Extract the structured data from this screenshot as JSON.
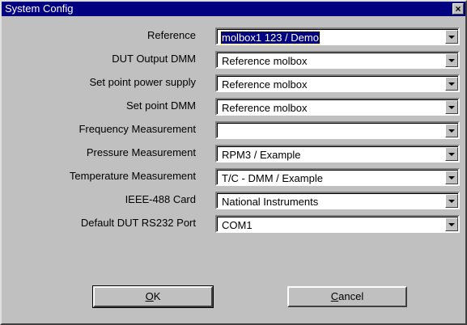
{
  "window": {
    "title": "System Config",
    "close_glyph": "×"
  },
  "fields": [
    {
      "label": "Reference",
      "value": "molbox1 123 / Demo",
      "selected": true
    },
    {
      "label": "DUT Output DMM",
      "value": "Reference molbox"
    },
    {
      "label": "Set point power supply",
      "value": "Reference molbox"
    },
    {
      "label": "Set point DMM",
      "value": "Reference molbox"
    },
    {
      "label": "Frequency Measurement",
      "value": ""
    },
    {
      "label": "Pressure Measurement",
      "value": "RPM3  / Example"
    },
    {
      "label": "Temperature Measurement",
      "value": "T/C - DMM  / Example"
    },
    {
      "label": "IEEE-488 Card",
      "value": "National Instruments"
    },
    {
      "label": "Default DUT RS232 Port",
      "value": "COM1"
    }
  ],
  "buttons": {
    "ok_mnemonic": "O",
    "ok_rest": "K",
    "cancel_mnemonic": "C",
    "cancel_rest": "ancel"
  },
  "colors": {
    "titlebar": "#000080",
    "face": "#c0c0c0",
    "selection": "#000080"
  }
}
